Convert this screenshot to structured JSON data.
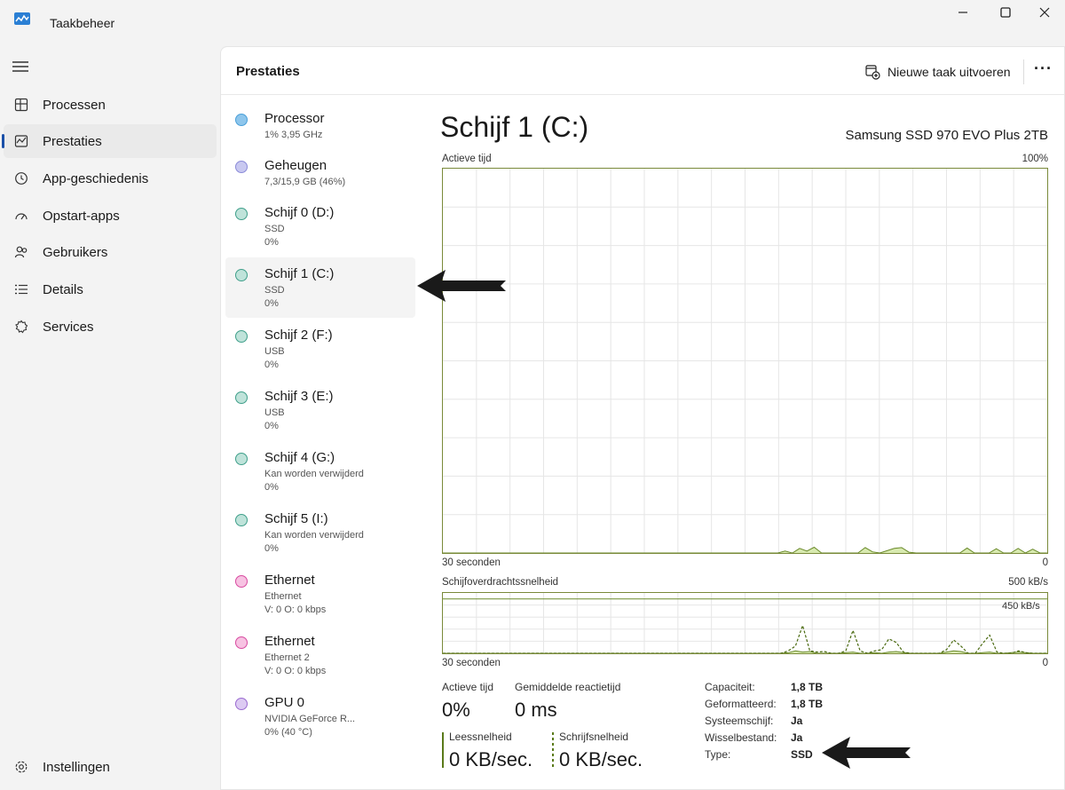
{
  "window": {
    "title": "Taakbeheer"
  },
  "sidebar": {
    "items": [
      {
        "label": "Processen",
        "icon": "processes-icon"
      },
      {
        "label": "Prestaties",
        "icon": "performance-icon",
        "active": true
      },
      {
        "label": "App-geschiedenis",
        "icon": "history-icon"
      },
      {
        "label": "Opstart-apps",
        "icon": "startup-icon"
      },
      {
        "label": "Gebruikers",
        "icon": "users-icon"
      },
      {
        "label": "Details",
        "icon": "details-icon"
      },
      {
        "label": "Services",
        "icon": "services-icon"
      }
    ],
    "settings_label": "Instellingen"
  },
  "header": {
    "title": "Prestaties",
    "run_task_label": "Nieuwe taak uitvoeren",
    "more_label": "···"
  },
  "devices": [
    {
      "name": "Processor",
      "sub1": "1% 3,95 GHz",
      "sub2": "",
      "color": "#4a9fd8"
    },
    {
      "name": "Geheugen",
      "sub1": "7,3/15,9 GB (46%)",
      "sub2": "",
      "color": "#8a8ad8"
    },
    {
      "name": "Schijf 0 (D:)",
      "sub1": "SSD",
      "sub2": "0%",
      "color": "#3f9f8a"
    },
    {
      "name": "Schijf 1 (C:)",
      "sub1": "SSD",
      "sub2": "0%",
      "color": "#3f9f8a",
      "selected": true
    },
    {
      "name": "Schijf 2 (F:)",
      "sub1": "USB",
      "sub2": "0%",
      "color": "#3f9f8a"
    },
    {
      "name": "Schijf 3 (E:)",
      "sub1": "USB",
      "sub2": "0%",
      "color": "#3f9f8a"
    },
    {
      "name": "Schijf 4 (G:)",
      "sub1": "Kan worden verwijderd",
      "sub2": "0%",
      "color": "#3f9f8a"
    },
    {
      "name": "Schijf 5 (I:)",
      "sub1": "Kan worden verwijderd",
      "sub2": "0%",
      "color": "#3f9f8a"
    },
    {
      "name": "Ethernet",
      "sub1": "Ethernet",
      "sub2": "V: 0 O: 0 kbps",
      "color": "#d84aa0"
    },
    {
      "name": "Ethernet",
      "sub1": "Ethernet 2",
      "sub2": "V: 0 O: 0 kbps",
      "color": "#d84aa0"
    },
    {
      "name": "GPU 0",
      "sub1": "NVIDIA GeForce R...",
      "sub2": "0% (40 °C)",
      "color": "#9a6ad0"
    }
  ],
  "detail": {
    "title": "Schijf 1 (C:)",
    "model": "Samsung SSD 970 EVO Plus 2TB",
    "chart1": {
      "label": "Actieve tijd",
      "max_label": "100%",
      "time_label": "30 seconden",
      "min_label": "0",
      "activity": [
        0,
        0,
        0,
        0,
        0,
        0,
        0,
        0,
        0,
        0,
        0,
        0,
        0,
        0,
        0,
        0,
        0,
        0,
        0,
        0,
        0,
        0,
        0,
        0,
        0,
        0,
        0,
        0,
        0,
        0,
        0,
        0,
        0,
        0,
        0,
        0,
        0,
        0,
        0,
        0,
        0,
        0,
        0,
        0,
        0,
        0,
        0,
        0.5,
        0,
        1.2,
        0.5,
        1.5,
        0,
        0,
        0,
        0,
        0,
        0,
        1.4,
        0.3,
        0,
        0.6,
        1.2,
        1.4,
        0.2,
        0,
        0,
        0,
        0,
        0,
        0,
        0,
        1.3,
        0,
        0,
        0,
        1.1,
        0,
        0,
        1.2,
        0,
        1.0,
        0,
        0
      ]
    },
    "chart2": {
      "label": "Schijfoverdrachtssnelheid",
      "max_label": "500 kB/s",
      "scale_label": "450 kB/s",
      "time_label": "30 seconden",
      "min_label": "0",
      "read": [
        0,
        0,
        0,
        0,
        0,
        0,
        0,
        0,
        0,
        0,
        0,
        0,
        0,
        0,
        0,
        0,
        0,
        0,
        0,
        0,
        0,
        0,
        0,
        0,
        0,
        0,
        0,
        0,
        0,
        0,
        0,
        0,
        0,
        0,
        0,
        0,
        0,
        0,
        0,
        0,
        0,
        0,
        0,
        0,
        0,
        0,
        0,
        0,
        5,
        20,
        10,
        15,
        0,
        0,
        0,
        0,
        5,
        10,
        0,
        0,
        5,
        0,
        10,
        15,
        5,
        0,
        0,
        0,
        0,
        0,
        10,
        20,
        15,
        0,
        0,
        5,
        10,
        0,
        0,
        5,
        10,
        5,
        0,
        0,
        0
      ],
      "write": [
        0,
        0,
        0,
        0,
        0,
        0,
        0,
        0,
        0,
        0,
        0,
        0,
        0,
        0,
        0,
        0,
        0,
        0,
        0,
        0,
        0,
        0,
        0,
        0,
        0,
        0,
        0,
        0,
        0,
        0,
        0,
        0,
        0,
        0,
        0,
        0,
        0,
        0,
        0,
        0,
        0,
        0,
        0,
        0,
        0,
        0,
        0,
        0,
        20,
        60,
        230,
        20,
        10,
        15,
        0,
        0,
        20,
        190,
        20,
        0,
        20,
        30,
        120,
        90,
        10,
        0,
        0,
        0,
        0,
        0,
        30,
        110,
        60,
        0,
        0,
        80,
        150,
        10,
        0,
        0,
        20,
        5,
        0,
        0,
        0
      ]
    },
    "stats": {
      "active_time_label": "Actieve tijd",
      "active_time_value": "0%",
      "response_label": "Gemiddelde reactietijd",
      "response_value": "0 ms",
      "read_label": "Leessnelheid",
      "read_value": "0 KB/sec.",
      "write_label": "Schrijfsnelheid",
      "write_value": "0 KB/sec."
    },
    "properties": [
      {
        "label": "Capaciteit:",
        "value": "1,8 TB"
      },
      {
        "label": "Geformatteerd:",
        "value": "1,8 TB"
      },
      {
        "label": "Systeemschijf:",
        "value": "Ja"
      },
      {
        "label": "Wisselbestand:",
        "value": "Ja"
      },
      {
        "label": "Type:",
        "value": "SSD"
      }
    ]
  },
  "colors": {
    "accent": "#1a4fa8",
    "chart_border": "#7a8a3a",
    "chart_fill": "#d8eab0",
    "chart_line": "#6a8a2a",
    "grid": "#e6e6e6"
  }
}
